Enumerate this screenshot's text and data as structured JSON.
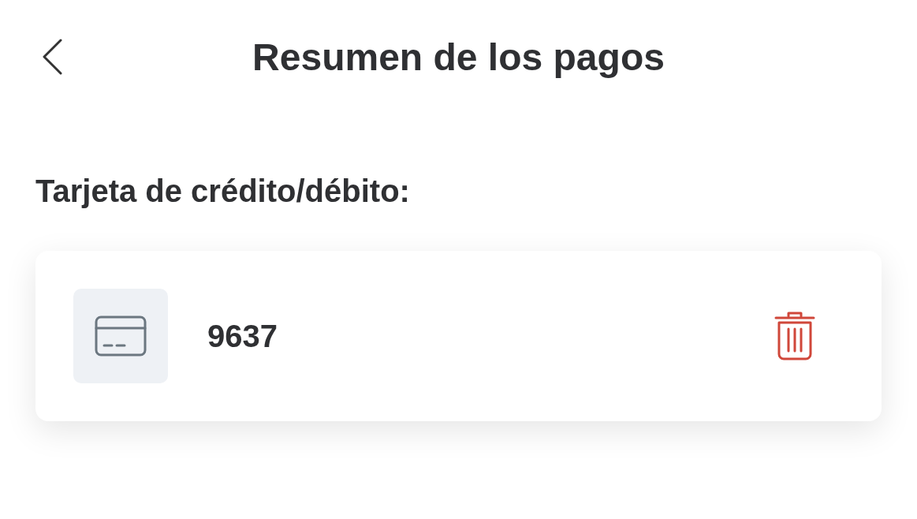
{
  "header": {
    "title": "Resumen de los pagos"
  },
  "section": {
    "label": "Tarjeta de crédito/débito:"
  },
  "cards": [
    {
      "number": "9637"
    }
  ]
}
